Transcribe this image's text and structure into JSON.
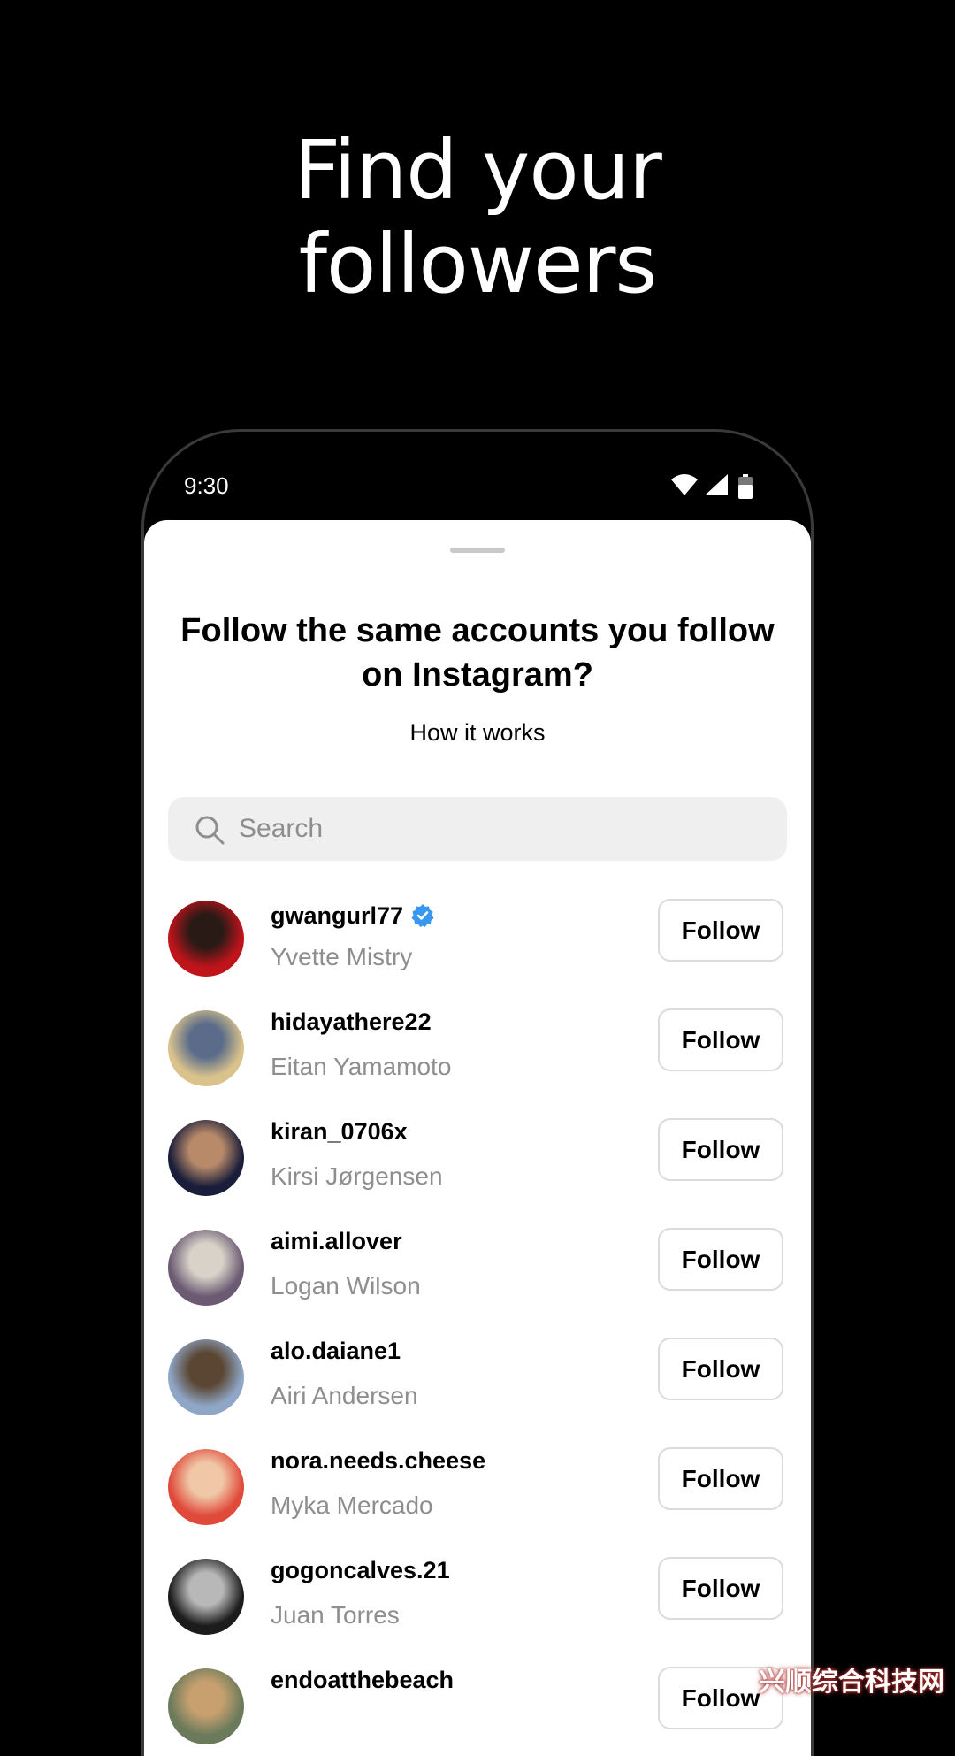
{
  "headline": {
    "line1": "Find your",
    "line2": "followers"
  },
  "status_bar": {
    "time": "9:30"
  },
  "sheet": {
    "title": "Follow the same accounts you follow on Instagram?",
    "how_it_works": "How it works",
    "search": {
      "placeholder": "Search",
      "value": ""
    }
  },
  "accounts": [
    {
      "username": "gwangurl77",
      "name": "Yvette Mistry",
      "verified": true,
      "follow_label": "Follow",
      "avatar_colors": [
        "#c0141b",
        "#2a1a16"
      ]
    },
    {
      "username": "hidayathere22",
      "name": "Eitan Yamamoto",
      "verified": false,
      "follow_label": "Follow",
      "avatar_colors": [
        "#d9c28c",
        "#5a6c8a"
      ]
    },
    {
      "username": "kiran_0706x",
      "name": "Kirsi Jørgensen",
      "verified": false,
      "follow_label": "Follow",
      "avatar_colors": [
        "#1a1e3a",
        "#b88a6a"
      ]
    },
    {
      "username": "aimi.allover",
      "name": "Logan Wilson",
      "verified": false,
      "follow_label": "Follow",
      "avatar_colors": [
        "#6b5a72",
        "#d8d2c8"
      ]
    },
    {
      "username": "alo.daiane1",
      "name": "Airi Andersen",
      "verified": false,
      "follow_label": "Follow",
      "avatar_colors": [
        "#8fa6c6",
        "#5a4632"
      ]
    },
    {
      "username": "nora.needs.cheese",
      "name": "Myka Mercado",
      "verified": false,
      "follow_label": "Follow",
      "avatar_colors": [
        "#e04a3a",
        "#f0c8a8"
      ]
    },
    {
      "username": "gogoncalves.21",
      "name": "Juan Torres",
      "verified": false,
      "follow_label": "Follow",
      "avatar_colors": [
        "#1c1c1c",
        "#b8b8b8"
      ]
    },
    {
      "username": "endoatthebeach",
      "name": "",
      "verified": false,
      "follow_label": "Follow",
      "avatar_colors": [
        "#6a7a5a",
        "#c8a070"
      ]
    }
  ],
  "colors": {
    "background": "#000000",
    "sheet": "#ffffff",
    "verified_badge": "#3897f0",
    "secondary_text": "#8e8e8e"
  },
  "watermark": "兴顺综合科技网"
}
